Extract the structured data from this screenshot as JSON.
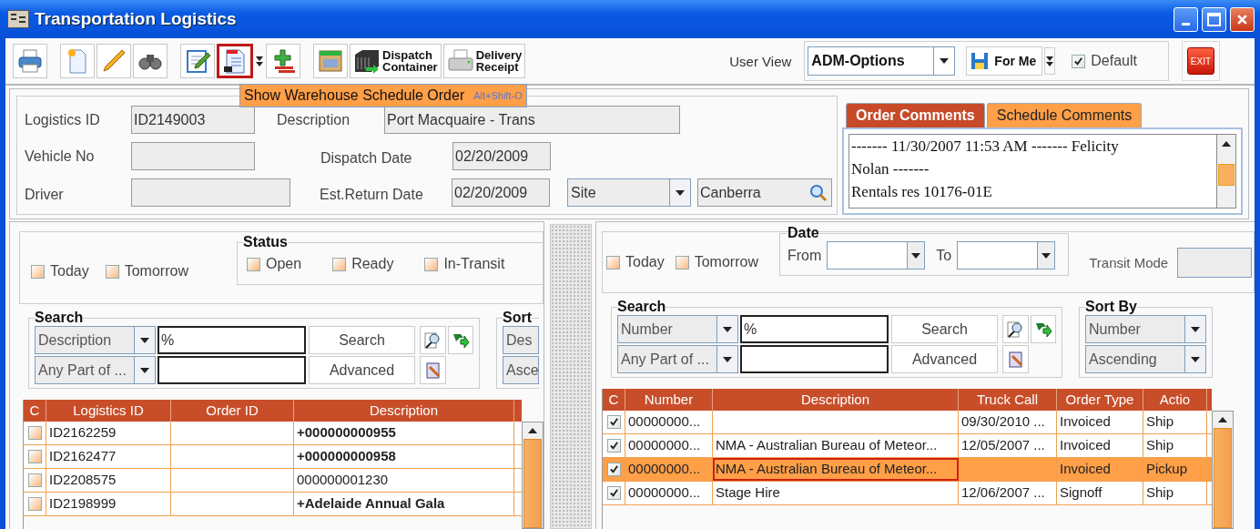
{
  "window": {
    "title": "Transportation Logistics"
  },
  "toolbar_groups": [
    {
      "buttons": [
        {
          "kind": "icon",
          "selected": false
        }
      ]
    },
    {
      "buttons": [
        {
          "kind": "icon",
          "selected": false
        },
        {
          "kind": "icon",
          "selected": false
        },
        {
          "kind": "icon",
          "selected": false
        }
      ]
    },
    {
      "buttons": [
        {
          "kind": "icon",
          "selected": false
        },
        {
          "kind": "icon",
          "selected": true
        },
        {
          "kind": "menu",
          "selected": false
        },
        {
          "kind": "icon",
          "selected": false
        }
      ]
    },
    {
      "buttons": [
        {
          "kind": "icon",
          "selected": false
        },
        {
          "kind": "labeled",
          "label": "Dispatch Container",
          "selected": false
        },
        {
          "kind": "labeled",
          "label": "Delivery Receipt",
          "selected": false
        }
      ]
    }
  ],
  "tooltip": {
    "text": "Show Warehouse Schedule Order",
    "shortcut": "Alt+Shift-O"
  },
  "user_view": {
    "label": "User View",
    "value": "ADM-Options",
    "save_label": "For Me",
    "default_label": "Default",
    "default_checked": true
  },
  "exit_label": "EXIT",
  "details": {
    "logistics_id": {
      "label": "Logistics ID",
      "value": "ID2149003"
    },
    "description": {
      "label": "Description",
      "value": "Port Macquaire - Trans"
    },
    "vehicle_no": {
      "label": "Vehicle No"
    },
    "dispatch_date": {
      "label": "Dispatch Date",
      "value": "02/20/2009"
    },
    "driver": {
      "label": "Driver"
    },
    "est_return_date": {
      "label": "Est.Return Date",
      "value": "02/20/2009"
    },
    "location_type": "Site",
    "location": "Canberra"
  },
  "comments": {
    "tabs": [
      {
        "label": "Order Comments",
        "selected": true
      },
      {
        "label": "Schedule Comments",
        "selected": false
      }
    ],
    "lines": [
      "------- 11/30/2007 11:53 AM ------- Felicity",
      "Nolan -------",
      "Rentals res 10176-01E"
    ]
  },
  "left_panel": {
    "quick_filters": [
      {
        "label": "Today",
        "checked": false
      },
      {
        "label": "Tomorrow",
        "checked": false
      }
    ],
    "status": {
      "title": "Status",
      "options": [
        {
          "label": "Open",
          "checked": false
        },
        {
          "label": "Ready",
          "checked": false
        },
        {
          "label": "In-Transit",
          "checked": false
        }
      ]
    },
    "search": {
      "title": "Search",
      "field": "Description",
      "match": "Any Part of ...",
      "value": "%",
      "search_button": "Search",
      "advanced_button": "Advanced"
    },
    "sort": {
      "title": "Sort",
      "field": "Des",
      "order": "Asce"
    },
    "table": {
      "columns": [
        "C",
        "Logistics ID",
        "Order ID",
        "Description"
      ],
      "rows": [
        {
          "checked": false,
          "bold": true,
          "logistics_id": "ID2162259",
          "description": "+000000000955"
        },
        {
          "checked": false,
          "bold": true,
          "logistics_id": "ID2162477",
          "description": "+000000000958"
        },
        {
          "checked": false,
          "bold": false,
          "logistics_id": "ID2208575",
          "description": "000000001230"
        },
        {
          "checked": false,
          "bold": true,
          "logistics_id": "ID2198999",
          "description": "+Adelaide Annual Gala"
        }
      ]
    }
  },
  "right_panel": {
    "quick_filters": [
      {
        "label": "Today",
        "checked": false
      },
      {
        "label": "Tomorrow",
        "checked": false
      }
    ],
    "date": {
      "title": "Date",
      "from_label": "From",
      "to_label": "To"
    },
    "transit_mode_label": "Transit Mode",
    "search": {
      "title": "Search",
      "field": "Number",
      "match": "Any Part of ...",
      "value": "%",
      "search_button": "Search",
      "advanced_button": "Advanced"
    },
    "sort": {
      "title": "Sort By",
      "field": "Number",
      "order": "Ascending"
    },
    "table": {
      "columns": [
        "C",
        "Number",
        "Description",
        "Truck Call",
        "Order Type",
        "Actio"
      ],
      "rows": [
        {
          "checked": true,
          "selected": false,
          "number": "00000000...",
          "truck_call": "09/30/2010 ...",
          "order_type": "Invoiced",
          "action": "Ship"
        },
        {
          "checked": true,
          "selected": false,
          "number": "00000000...",
          "description": "NMA - Australian Bureau of Meteor...",
          "truck_call": "12/05/2007 ...",
          "order_type": "Invoiced",
          "action": "Ship"
        },
        {
          "checked": true,
          "selected": true,
          "number": "00000000...",
          "description": "NMA - Australian Bureau of Meteor...",
          "order_type": "Invoiced",
          "action": "Pickup"
        },
        {
          "checked": true,
          "selected": false,
          "number": "00000000...",
          "description": "Stage Hire",
          "truck_call": "12/06/2007 ...",
          "order_type": "Signoff",
          "action": "Ship"
        }
      ]
    }
  }
}
